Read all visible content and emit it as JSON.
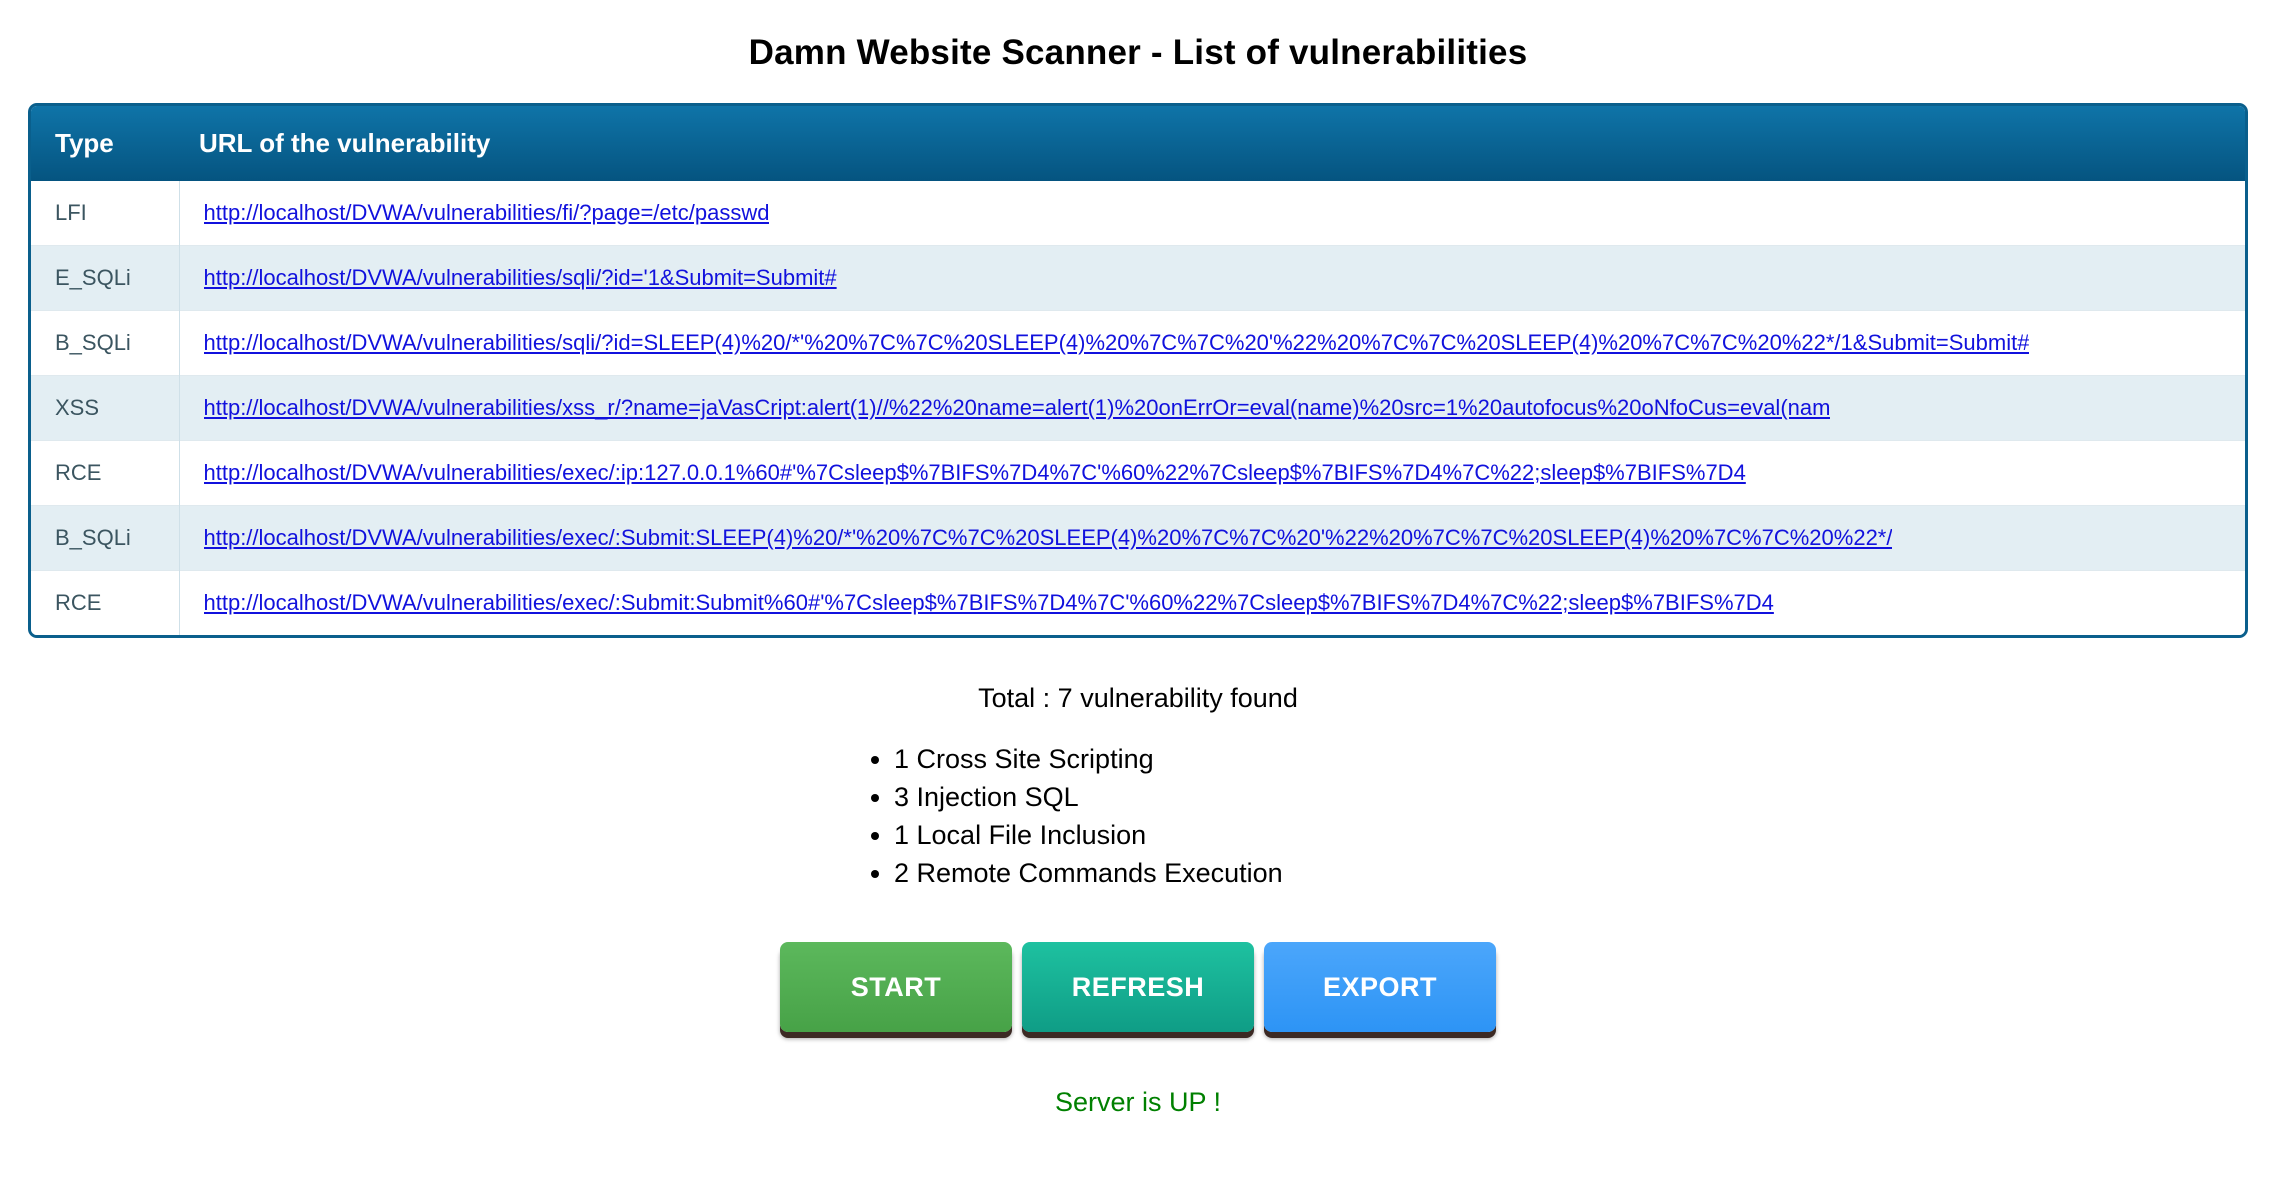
{
  "page": {
    "title": "Damn Website Scanner - List of vulnerabilities"
  },
  "table": {
    "headers": {
      "type": "Type",
      "url": "URL of the vulnerability"
    },
    "rows": [
      {
        "type": "LFI",
        "url": "http://localhost/DVWA/vulnerabilities/fi/?page=/etc/passwd"
      },
      {
        "type": "E_SQLi",
        "url": "http://localhost/DVWA/vulnerabilities/sqli/?id='1&Submit=Submit#"
      },
      {
        "type": "B_SQLi",
        "url": "http://localhost/DVWA/vulnerabilities/sqli/?id=SLEEP(4)%20/*'%20%7C%7C%20SLEEP(4)%20%7C%7C%20'%22%20%7C%7C%20SLEEP(4)%20%7C%7C%20%22*/1&Submit=Submit#"
      },
      {
        "type": "XSS",
        "url": "http://localhost/DVWA/vulnerabilities/xss_r/?name=jaVasCript:alert(1)//%22%20name=alert(1)%20onErrOr=eval(name)%20src=1%20autofocus%20oNfoCus=eval(nam"
      },
      {
        "type": "RCE",
        "url": "http://localhost/DVWA/vulnerabilities/exec/:ip:127.0.0.1%60#'%7Csleep$%7BIFS%7D4%7C'%60%22%7Csleep$%7BIFS%7D4%7C%22;sleep$%7BIFS%7D4"
      },
      {
        "type": "B_SQLi",
        "url": "http://localhost/DVWA/vulnerabilities/exec/:Submit:SLEEP(4)%20/*'%20%7C%7C%20SLEEP(4)%20%7C%7C%20'%22%20%7C%7C%20SLEEP(4)%20%7C%7C%20%22*/"
      },
      {
        "type": "RCE",
        "url": "http://localhost/DVWA/vulnerabilities/exec/:Submit:Submit%60#'%7Csleep$%7BIFS%7D4%7C'%60%22%7Csleep$%7BIFS%7D4%7C%22;sleep$%7BIFS%7D4"
      }
    ]
  },
  "summary": {
    "total": "Total : 7 vulnerability found",
    "items": [
      "1 Cross Site Scripting",
      "3 Injection SQL",
      "1 Local File Inclusion",
      "2 Remote Commands Execution"
    ]
  },
  "buttons": {
    "start": "START",
    "refresh": "REFRESH",
    "export": "EXPORT"
  },
  "status": {
    "text": "Server is UP !",
    "color": "#008000"
  },
  "colors": {
    "header_gradient_top": "#0f74a8",
    "header_gradient_bottom": "#055480",
    "table_border": "#0a5f8c",
    "row_alt": "#e3eef3",
    "link": "#1111dd",
    "type_text": "#3b5560",
    "btn_start": "#5cb85c",
    "btn_refresh": "#1ec1a0",
    "btn_export": "#4ba6fb"
  }
}
